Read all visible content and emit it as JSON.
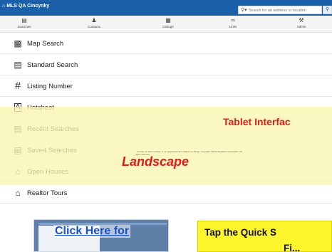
{
  "app": {
    "title": "MLS QA Cincynky",
    "search_placeholder": "Search for an address or location",
    "brand_color": "#1a5fa8"
  },
  "nav": {
    "items": [
      {
        "label": "Searches",
        "icon": "searches-icon"
      },
      {
        "label": "Contacts",
        "icon": "contacts-icon"
      },
      {
        "label": "Listings",
        "icon": "listings-icon"
      },
      {
        "label": "Links",
        "icon": "links-icon"
      },
      {
        "label": "Admin",
        "icon": "admin-icon"
      }
    ]
  },
  "menu": {
    "items": [
      {
        "label": "Map Search",
        "icon": "map-search-icon"
      },
      {
        "label": "Standard Search",
        "icon": "standard-search-icon"
      },
      {
        "label": "Listing Number",
        "icon": "hash-icon"
      },
      {
        "label": "Hotsheet",
        "icon": "hotsheet-icon"
      },
      {
        "label": "Recent Searches",
        "icon": "recent-searches-icon"
      },
      {
        "label": "Saved Searches",
        "icon": "saved-searches-icon"
      },
      {
        "label": "Open Houses",
        "icon": "open-houses-icon"
      },
      {
        "label": "Realtor Tours",
        "icon": "realtor-tours-icon"
      }
    ]
  },
  "overlay": {
    "title": "Tablet Interfac",
    "subtitle": "Landscape",
    "note": "...ion has not been verified, is not guaranteed and subject to change. Copyright ©2014 Rapattoni Corporation. All rights reserved.",
    "accent_color": "#e01b1b"
  },
  "bottom": {
    "link_text": "Click Here for",
    "callout_line1": "Tap the Quick S",
    "callout_line2": "Fi..."
  }
}
